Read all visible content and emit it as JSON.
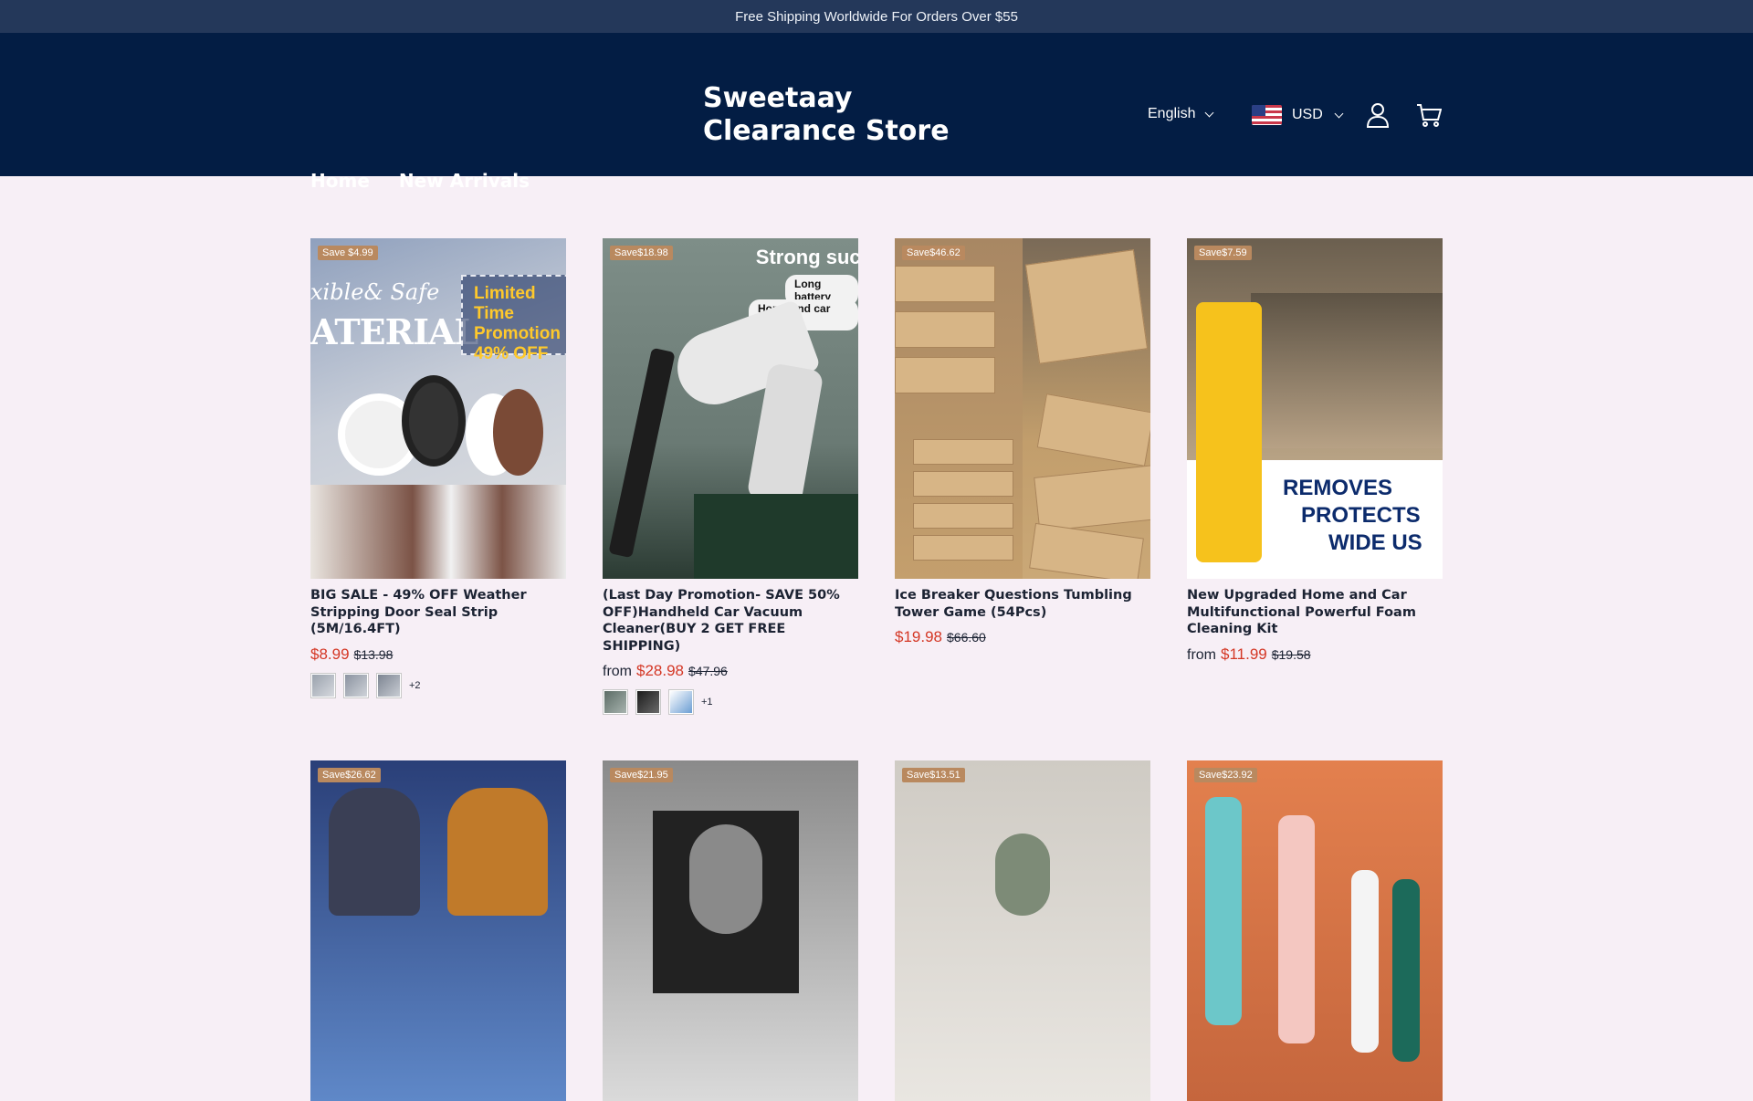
{
  "announcement": "Free Shipping Worldwide For Orders Over $55",
  "store_name": "Sweetaay Clearance Store",
  "language": "English",
  "currency": "USD",
  "nav": [
    {
      "label": "Home"
    },
    {
      "label": "New Arrivals"
    }
  ],
  "products": [
    {
      "badge": "Save $4.99",
      "title": "BIG SALE - 49% OFF Weather Stripping Door Seal Strip (5M/16.4FT)",
      "from": "",
      "price": "$8.99",
      "compare": "$13.98",
      "more": "+2"
    },
    {
      "badge": "Save$18.98",
      "title": "(Last Day Promotion- SAVE 50% OFF)Handheld Car Vacuum Cleaner(BUY 2 GET FREE SHIPPING)",
      "from": "from",
      "price": "$28.98",
      "compare": "$47.96",
      "more": "+1"
    },
    {
      "badge": "Save$46.62",
      "title": "Ice Breaker Questions Tumbling Tower Game (54Pcs)",
      "from": "",
      "price": "$19.98",
      "compare": "$66.60",
      "more": ""
    },
    {
      "badge": "Save$7.59",
      "title": "New Upgraded Home and Car Multifunctional Powerful Foam Cleaning Kit",
      "from": "from",
      "price": "$11.99",
      "compare": "$19.58",
      "more": ""
    },
    {
      "badge": "Save$26.62"
    },
    {
      "badge": "Save$21.95"
    },
    {
      "badge": "Save$13.51"
    },
    {
      "badge": "Save$23.92"
    }
  ],
  "image_text": {
    "p1_script": "xible& Safe",
    "p1_headline": "ATERIAL",
    "p1_promo": "Limited Time Promotion 49% OFF",
    "p2_headline": "Strong suct",
    "p2_pill1": "Long battery",
    "p2_pill2": "Home and car dual",
    "p4_lines": [
      "REMOVES",
      "PROTECTS",
      "WIDE US"
    ]
  },
  "colors": {
    "header": "#031d44",
    "announcement": "#24385a",
    "sale": "#d43725",
    "badge": "#b9895f",
    "page_bg": "#f7eff6"
  }
}
